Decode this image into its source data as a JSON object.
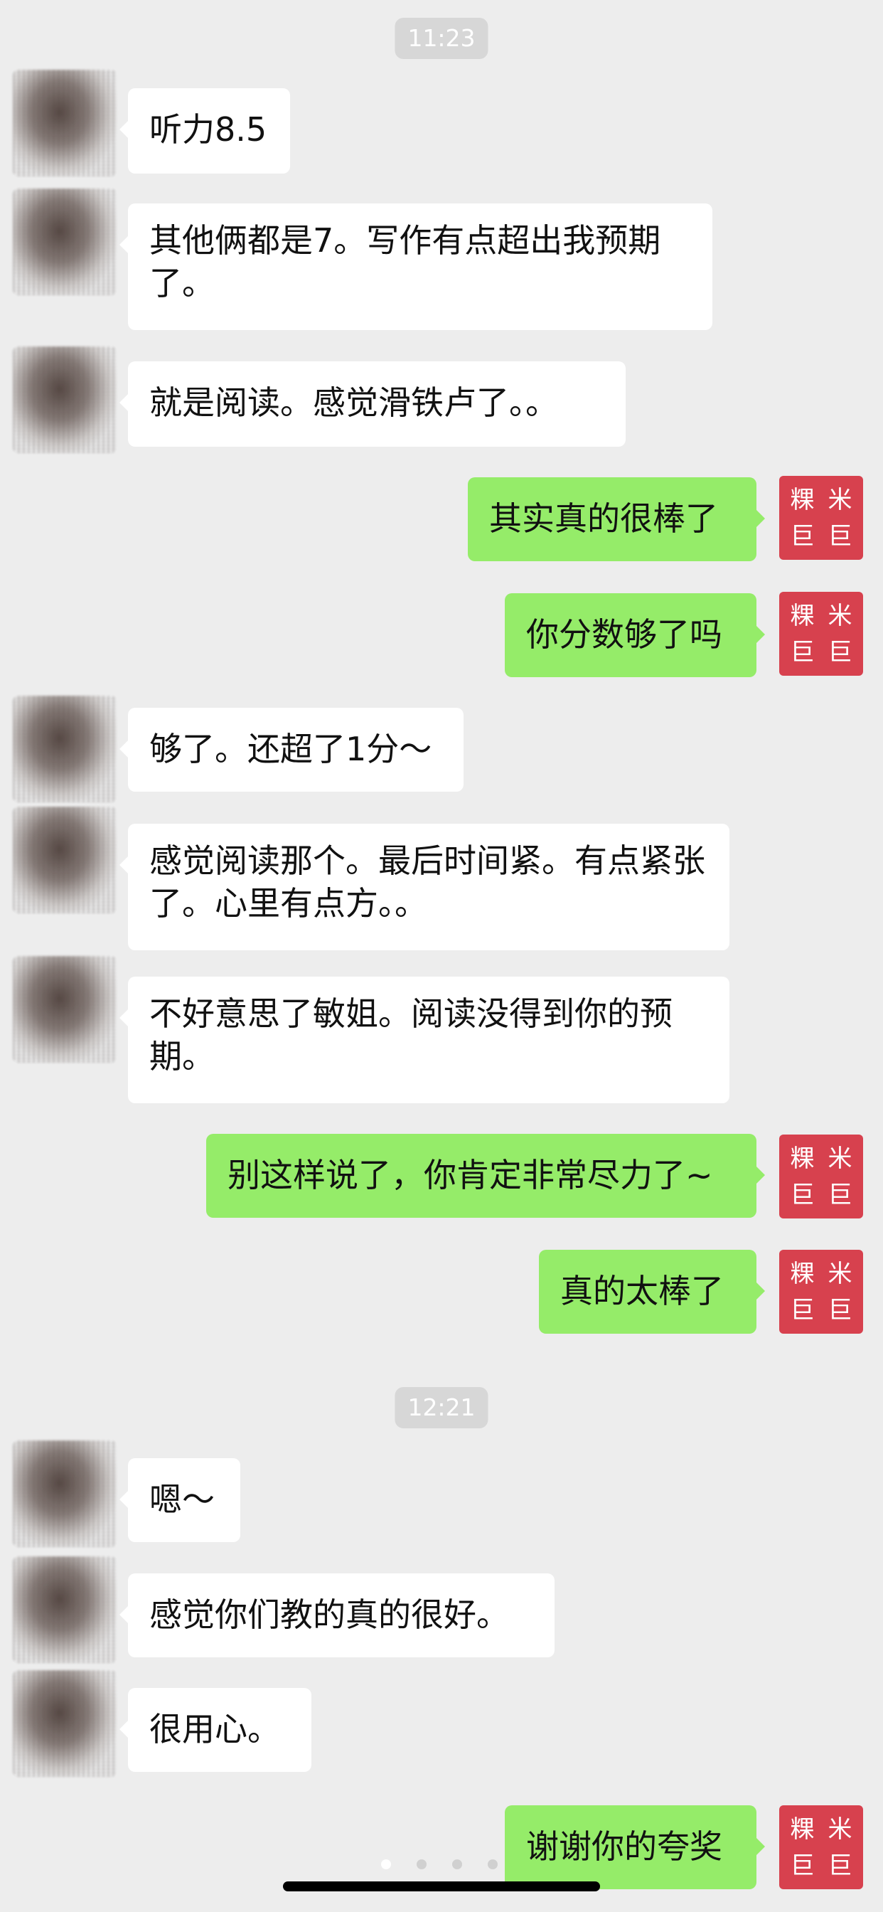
{
  "chat": {
    "time_1": "11:23",
    "time_2": "12:21",
    "messages": [
      {
        "side": "left",
        "text": "听力8.5"
      },
      {
        "side": "left",
        "text": "其他俩都是7。写作有点超出我预期了。"
      },
      {
        "side": "left",
        "text": "就是阅读。感觉滑铁卢了。。"
      },
      {
        "side": "right",
        "text": "其实真的很棒了"
      },
      {
        "side": "right",
        "text": "你分数够了吗"
      },
      {
        "side": "left",
        "text": "够了。还超了1分～"
      },
      {
        "side": "left",
        "text": "感觉阅读那个。最后时间紧。有点紧张了。心里有点方。。"
      },
      {
        "side": "left",
        "text": "不好意思了敏姐。阅读没得到你的预期。"
      },
      {
        "side": "right",
        "text": "别这样说了，你肯定非常尽力了~"
      },
      {
        "side": "right",
        "text": "真的太棒了"
      },
      {
        "side": "left",
        "text": "嗯～"
      },
      {
        "side": "left",
        "text": "感觉你们教的真的很好。"
      },
      {
        "side": "left",
        "text": "很用心。"
      },
      {
        "side": "right",
        "text": "谢谢你的夸奖"
      }
    ]
  },
  "avatar_stamp": [
    "粿",
    "米",
    "巨",
    "巨"
  ]
}
